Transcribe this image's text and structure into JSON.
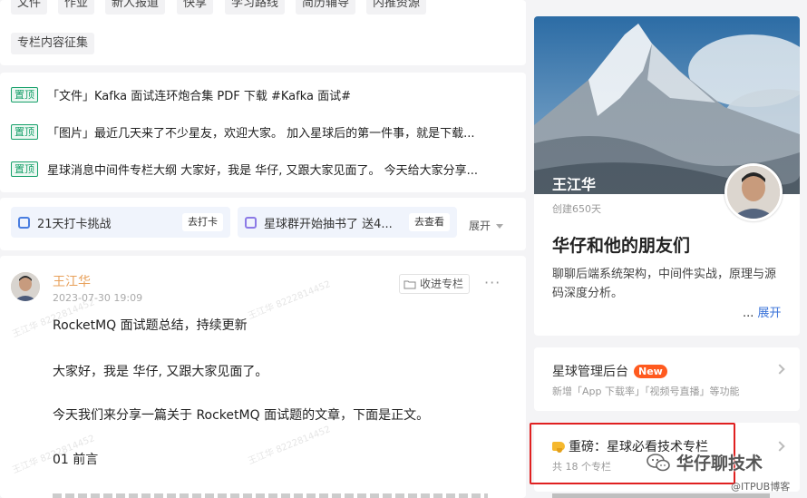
{
  "tags": {
    "row1": [
      "文件",
      "作业",
      "新人报道",
      "快享",
      "学习路线",
      "简历辅导",
      "内推资源"
    ],
    "row2": [
      "专栏内容征集"
    ]
  },
  "pinned": {
    "badge": "置顶",
    "items": [
      "「文件」Kafka 面试连环炮合集 PDF 下载 #Kafka 面试#",
      "「图片」最近几天来了不少星友，欢迎大家。 加入星球后的第一件事，就是下载...",
      "星球消息中间件专栏大纲 大家好，我是 华仔, 又跟大家见面了。 今天给大家分享..."
    ]
  },
  "quick": {
    "items": [
      {
        "label": "21天打卡挑战",
        "action": "去打卡"
      },
      {
        "label": "星球群开始抽书了 送4...",
        "action": "去查看"
      }
    ],
    "expand": "展开"
  },
  "post": {
    "author": "王江华",
    "date": "2023-07-30 19:09",
    "collect": "收进专栏",
    "lines": [
      "RocketMQ 面试题总结，持续更新",
      "大家好，我是 华仔, 又跟大家见面了。",
      "今天我们来分享一篇关于 RocketMQ 面试题的文章，下面是正文。",
      "01 前言"
    ],
    "watermark": "王江华 8222814452"
  },
  "profile": {
    "owner": "王江华",
    "created": "创建650天",
    "title": "华仔和他的朋友们",
    "desc": "聊聊后端系统架构，中间件实战，原理与源码深度分析。",
    "ellipsis": "...",
    "expand": "展开"
  },
  "admin": {
    "title": "星球管理后台",
    "badge": "New",
    "sub": "新增「App 下载率」「视频号直播」等功能"
  },
  "columns": {
    "title": "重磅：星球必看技术专栏",
    "sub": "共 18 个专栏"
  },
  "overlay": {
    "wechat": "华仔聊技术",
    "itpub": "@ITPUB博客"
  },
  "colors": {
    "pin_green": "#16a06a",
    "author_orange": "#e8a05a",
    "link_blue": "#3a73d9",
    "new_badge": "#ff5a1f",
    "highlight_red": "#e02020"
  }
}
